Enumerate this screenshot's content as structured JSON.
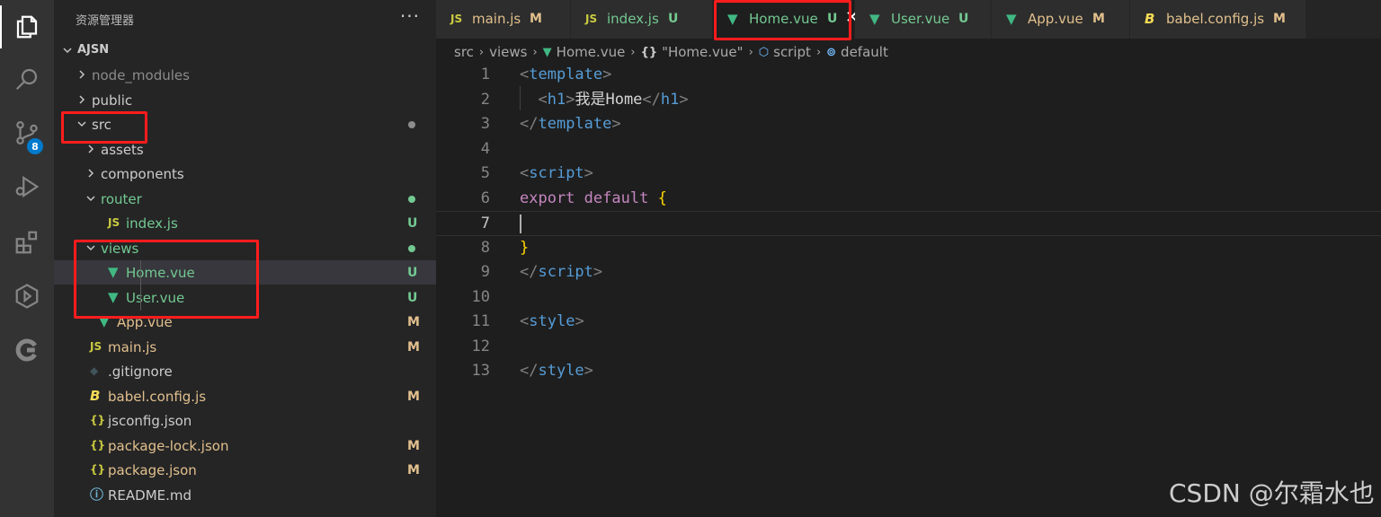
{
  "sidebar": {
    "title": "资源管理器",
    "more_actions": "···",
    "folder": "AJSN",
    "items": [
      {
        "name": "node_modules",
        "kind": "folder",
        "expanded": false,
        "depth": 0,
        "color": "#8c8c8c",
        "status": "",
        "dot": ""
      },
      {
        "name": "public",
        "kind": "folder",
        "expanded": false,
        "depth": 0,
        "color": "#cccccc",
        "status": "",
        "dot": ""
      },
      {
        "name": "src",
        "kind": "folder",
        "expanded": true,
        "depth": 0,
        "color": "#cccccc",
        "status": "",
        "dot": "#8d8d8d"
      },
      {
        "name": "assets",
        "kind": "folder",
        "expanded": false,
        "depth": 1,
        "color": "#cccccc",
        "status": "",
        "dot": ""
      },
      {
        "name": "components",
        "kind": "folder",
        "expanded": false,
        "depth": 1,
        "color": "#cccccc",
        "status": "",
        "dot": ""
      },
      {
        "name": "router",
        "kind": "folder",
        "expanded": true,
        "depth": 1,
        "color": "#73c991",
        "status": "",
        "dot": "#73c991"
      },
      {
        "name": "index.js",
        "kind": "js",
        "depth": 2,
        "color": "#73c991",
        "status": "U",
        "dot": ""
      },
      {
        "name": "views",
        "kind": "folder",
        "expanded": true,
        "depth": 1,
        "color": "#73c991",
        "status": "",
        "dot": "#73c991"
      },
      {
        "name": "Home.vue",
        "kind": "vue",
        "depth": 2,
        "color": "#73c991",
        "status": "U",
        "dot": "",
        "selected": true
      },
      {
        "name": "User.vue",
        "kind": "vue",
        "depth": 2,
        "color": "#73c991",
        "status": "U",
        "dot": ""
      },
      {
        "name": "App.vue",
        "kind": "vue",
        "depth": 1,
        "color": "#e2c08d",
        "status": "M",
        "dot": ""
      },
      {
        "name": "main.js",
        "kind": "js",
        "depth": 0,
        "color": "#e2c08d",
        "status": "M",
        "dot": ""
      },
      {
        "name": ".gitignore",
        "kind": "git",
        "depth": 0,
        "color": "#cccccc",
        "status": "",
        "dot": ""
      },
      {
        "name": "babel.config.js",
        "kind": "babel",
        "depth": 0,
        "color": "#e2c08d",
        "status": "M",
        "dot": ""
      },
      {
        "name": "jsconfig.json",
        "kind": "json",
        "depth": 0,
        "color": "#cccccc",
        "status": "",
        "dot": ""
      },
      {
        "name": "package-lock.json",
        "kind": "json",
        "depth": 0,
        "color": "#e2c08d",
        "status": "M",
        "dot": ""
      },
      {
        "name": "package.json",
        "kind": "json",
        "depth": 0,
        "color": "#e2c08d",
        "status": "M",
        "dot": ""
      },
      {
        "name": "README.md",
        "kind": "info",
        "depth": 0,
        "color": "#cccccc",
        "status": "",
        "dot": ""
      }
    ]
  },
  "activity": {
    "scm_badge": "8",
    "icons": [
      "explorer-icon",
      "search-icon",
      "source-control-icon",
      "run-debug-icon",
      "extensions-icon",
      "remote-explorer-icon",
      "account-icon"
    ]
  },
  "tabs": [
    {
      "label": "main.js",
      "kind": "js",
      "status": "M",
      "color": "#e2c08d",
      "active": false
    },
    {
      "label": "index.js",
      "kind": "js",
      "status": "U",
      "color": "#73c991",
      "active": false
    },
    {
      "label": "Home.vue",
      "kind": "vue",
      "status": "U",
      "color": "#73c991",
      "active": true,
      "close": "✕"
    },
    {
      "label": "User.vue",
      "kind": "vue",
      "status": "U",
      "color": "#73c991",
      "active": false
    },
    {
      "label": "App.vue",
      "kind": "vue",
      "status": "M",
      "color": "#e2c08d",
      "active": false
    },
    {
      "label": "babel.config.js",
      "kind": "babel",
      "status": "M",
      "color": "#e2c08d",
      "active": false
    }
  ],
  "breadcrumb": [
    {
      "label": "src",
      "icon": ""
    },
    {
      "label": "views",
      "icon": ""
    },
    {
      "label": "Home.vue",
      "icon": "vue"
    },
    {
      "label": "\"Home.vue\"",
      "icon": "braces"
    },
    {
      "label": "script",
      "icon": "cube"
    },
    {
      "label": "default",
      "icon": "symbol"
    }
  ],
  "editor": {
    "current_line": 7,
    "lines": [
      [
        [
          "t-br",
          "<"
        ],
        [
          "t-tag",
          "template"
        ],
        [
          "t-br",
          ">"
        ]
      ],
      [
        [
          "t-txt",
          "  "
        ],
        [
          "t-br",
          "<"
        ],
        [
          "t-tag",
          "h1"
        ],
        [
          "t-br",
          ">"
        ],
        [
          "t-txt",
          "我是Home"
        ],
        [
          "t-br",
          "</"
        ],
        [
          "t-tag",
          "h1"
        ],
        [
          "t-br",
          ">"
        ]
      ],
      [
        [
          "t-br",
          "</"
        ],
        [
          "t-tag",
          "template"
        ],
        [
          "t-br",
          ">"
        ]
      ],
      [],
      [
        [
          "t-br",
          "<"
        ],
        [
          "t-tag",
          "script"
        ],
        [
          "t-br",
          ">"
        ]
      ],
      [
        [
          "t-kw",
          "export"
        ],
        [
          "t-txt",
          " "
        ],
        [
          "t-kw",
          "default"
        ],
        [
          "t-txt",
          " "
        ],
        [
          "t-brace",
          "{"
        ]
      ],
      [],
      [
        [
          "t-brace",
          "}"
        ]
      ],
      [
        [
          "t-br",
          "</"
        ],
        [
          "t-tag",
          "script"
        ],
        [
          "t-br",
          ">"
        ]
      ],
      [],
      [
        [
          "t-br",
          "<"
        ],
        [
          "t-tag",
          "style"
        ],
        [
          "t-br",
          ">"
        ]
      ],
      [],
      [
        [
          "t-br",
          "</"
        ],
        [
          "t-tag",
          "style"
        ],
        [
          "t-br",
          ">"
        ]
      ]
    ]
  },
  "watermark": "CSDN @尔霜水也",
  "colors": {
    "vue_icon": "#41b883",
    "js_icon": "#cbcb41",
    "json_icon": "#cbcb41",
    "babel_icon": "#f5da55",
    "info_icon": "#6fb3d2",
    "git_icon": "#41535b",
    "highlight": "#ff1c1c"
  }
}
